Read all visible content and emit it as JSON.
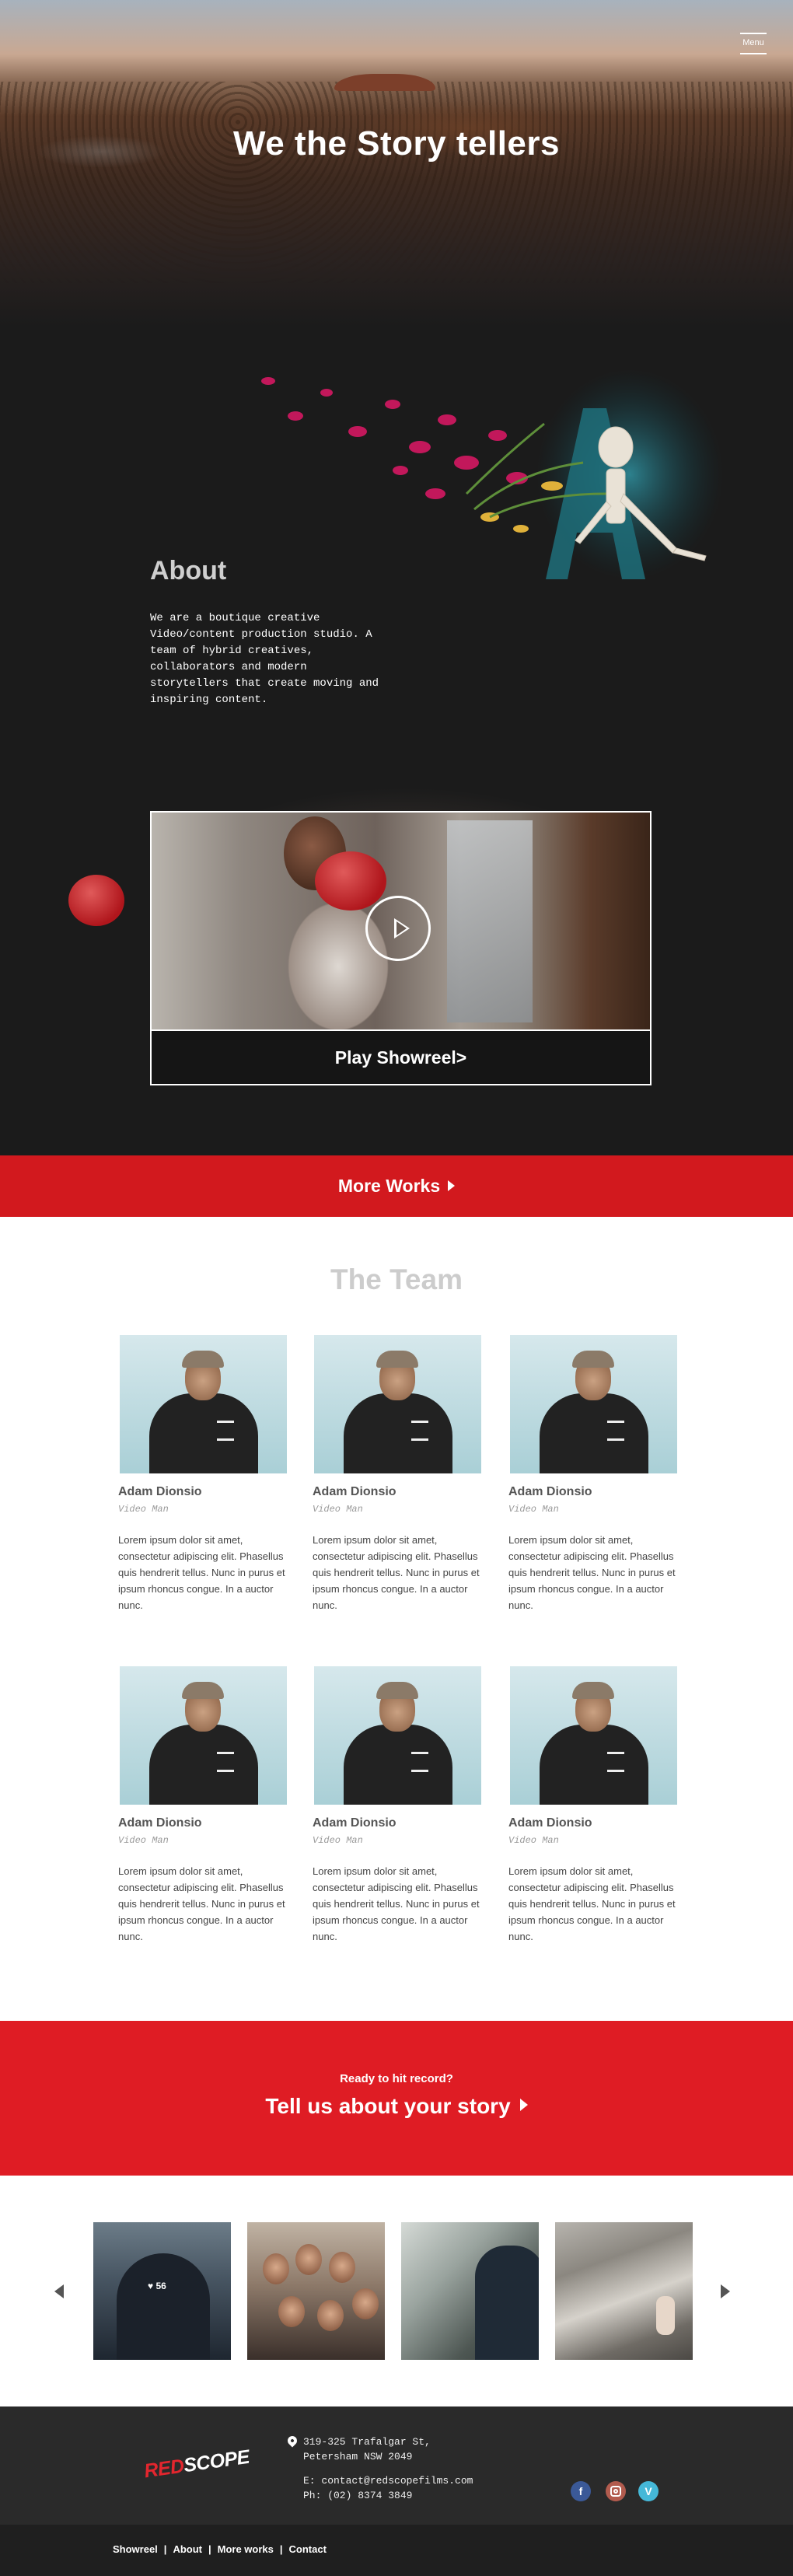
{
  "hero": {
    "menu_label": "Menu",
    "title": "We the Story tellers"
  },
  "about": {
    "heading": "About",
    "text": "We are a boutique creative Video/content production studio. A team of hybrid creatives, collaborators and modern storytellers that create moving and inspiring content."
  },
  "showreel": {
    "label": "Play Showreel>"
  },
  "more_works": {
    "label": "More Works"
  },
  "team": {
    "title": "The Team",
    "members": [
      {
        "name": "Adam Dionsio",
        "role": "Video Man",
        "bio": "Lorem ipsum dolor sit amet, consectetur adipiscing elit. Phasellus quis hendrerit  tellus. Nunc in purus et ipsum rhoncus congue. In a auctor nunc."
      },
      {
        "name": "Adam Dionsio",
        "role": "Video Man",
        "bio": "Lorem ipsum dolor sit amet, consectetur adipiscing elit. Phasellus quis hendrerit  tellus. Nunc in purus et ipsum rhoncus congue. In a auctor nunc."
      },
      {
        "name": "Adam Dionsio",
        "role": "Video Man",
        "bio": "Lorem ipsum dolor sit amet, consectetur adipiscing elit. Phasellus quis hendrerit  tellus. Nunc in purus et ipsum rhoncus congue. In a auctor nunc."
      },
      {
        "name": "Adam Dionsio",
        "role": "Video Man",
        "bio": "Lorem ipsum dolor sit amet, consectetur adipiscing elit. Phasellus quis hendrerit  tellus. Nunc in purus et ipsum rhoncus congue. In a auctor nunc."
      },
      {
        "name": "Adam Dionsio",
        "role": "Video Man",
        "bio": "Lorem ipsum dolor sit amet, consectetur adipiscing elit. Phasellus quis hendrerit  tellus. Nunc in purus et ipsum rhoncus congue. In a auctor nunc."
      },
      {
        "name": "Adam Dionsio",
        "role": "Video Man",
        "bio": "Lorem ipsum dolor sit amet, consectetur adipiscing elit. Phasellus quis hendrerit  tellus. Nunc in purus et ipsum rhoncus congue. In a auctor nunc."
      }
    ]
  },
  "cta": {
    "small": "Ready to hit record?",
    "big": "Tell us about your story"
  },
  "gallery": {
    "thumb1_text": "♥ 56"
  },
  "footer": {
    "logo_red": "RED",
    "logo_white": "SCOPE",
    "address_line1": "319-325 Trafalgar St,",
    "address_line2": "Petersham NSW 2049",
    "email": "E: contact@redscopefilms.com",
    "phone": "Ph: (02) 8374 3849",
    "facebook_glyph": "f",
    "vimeo_glyph": "V"
  },
  "bottom_nav": {
    "links": [
      "Showreel",
      "About",
      "More works",
      "Contact"
    ]
  },
  "colors": {
    "brand_red": "#d2191e",
    "cta_red": "#df1c24",
    "dark_bg": "#1b1b1b",
    "footer_bg": "#2a2a2a"
  },
  "icons": [
    "menu-icon",
    "play-icon",
    "caret-right-icon",
    "arrow-left-icon",
    "arrow-right-icon",
    "location-pin-icon",
    "facebook-icon",
    "instagram-icon",
    "vimeo-icon"
  ]
}
